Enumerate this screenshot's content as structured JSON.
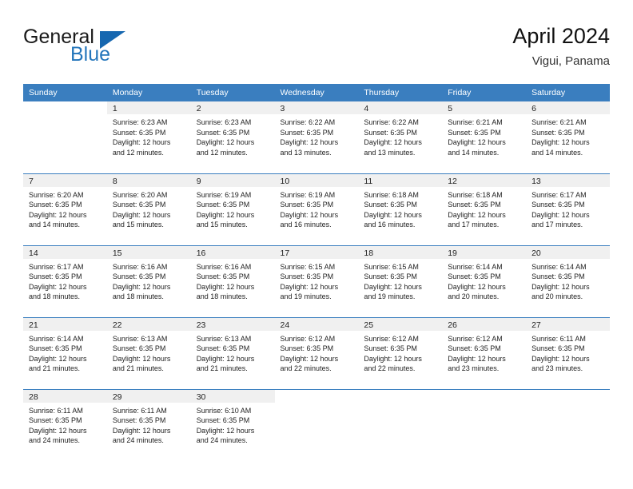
{
  "logo": {
    "word_one": "General",
    "word_two": "Blue",
    "triangle": "blue-triangle"
  },
  "header": {
    "title": "April 2024",
    "subtitle": "Vigui, Panama"
  },
  "colors": {
    "header_blue": "#3a7ebf",
    "daynum_bg": "#f0f0f0",
    "logo_blue": "#2375bb",
    "text": "#222222"
  },
  "weekdays": [
    "Sunday",
    "Monday",
    "Tuesday",
    "Wednesday",
    "Thursday",
    "Friday",
    "Saturday"
  ],
  "weeks": [
    [
      {
        "day": "",
        "lines": [
          "",
          "",
          "",
          ""
        ]
      },
      {
        "day": "1",
        "lines": [
          "Sunrise: 6:23 AM",
          "Sunset: 6:35 PM",
          "Daylight: 12 hours",
          "and 12 minutes."
        ]
      },
      {
        "day": "2",
        "lines": [
          "Sunrise: 6:23 AM",
          "Sunset: 6:35 PM",
          "Daylight: 12 hours",
          "and 12 minutes."
        ]
      },
      {
        "day": "3",
        "lines": [
          "Sunrise: 6:22 AM",
          "Sunset: 6:35 PM",
          "Daylight: 12 hours",
          "and 13 minutes."
        ]
      },
      {
        "day": "4",
        "lines": [
          "Sunrise: 6:22 AM",
          "Sunset: 6:35 PM",
          "Daylight: 12 hours",
          "and 13 minutes."
        ]
      },
      {
        "day": "5",
        "lines": [
          "Sunrise: 6:21 AM",
          "Sunset: 6:35 PM",
          "Daylight: 12 hours",
          "and 14 minutes."
        ]
      },
      {
        "day": "6",
        "lines": [
          "Sunrise: 6:21 AM",
          "Sunset: 6:35 PM",
          "Daylight: 12 hours",
          "and 14 minutes."
        ]
      }
    ],
    [
      {
        "day": "7",
        "lines": [
          "Sunrise: 6:20 AM",
          "Sunset: 6:35 PM",
          "Daylight: 12 hours",
          "and 14 minutes."
        ]
      },
      {
        "day": "8",
        "lines": [
          "Sunrise: 6:20 AM",
          "Sunset: 6:35 PM",
          "Daylight: 12 hours",
          "and 15 minutes."
        ]
      },
      {
        "day": "9",
        "lines": [
          "Sunrise: 6:19 AM",
          "Sunset: 6:35 PM",
          "Daylight: 12 hours",
          "and 15 minutes."
        ]
      },
      {
        "day": "10",
        "lines": [
          "Sunrise: 6:19 AM",
          "Sunset: 6:35 PM",
          "Daylight: 12 hours",
          "and 16 minutes."
        ]
      },
      {
        "day": "11",
        "lines": [
          "Sunrise: 6:18 AM",
          "Sunset: 6:35 PM",
          "Daylight: 12 hours",
          "and 16 minutes."
        ]
      },
      {
        "day": "12",
        "lines": [
          "Sunrise: 6:18 AM",
          "Sunset: 6:35 PM",
          "Daylight: 12 hours",
          "and 17 minutes."
        ]
      },
      {
        "day": "13",
        "lines": [
          "Sunrise: 6:17 AM",
          "Sunset: 6:35 PM",
          "Daylight: 12 hours",
          "and 17 minutes."
        ]
      }
    ],
    [
      {
        "day": "14",
        "lines": [
          "Sunrise: 6:17 AM",
          "Sunset: 6:35 PM",
          "Daylight: 12 hours",
          "and 18 minutes."
        ]
      },
      {
        "day": "15",
        "lines": [
          "Sunrise: 6:16 AM",
          "Sunset: 6:35 PM",
          "Daylight: 12 hours",
          "and 18 minutes."
        ]
      },
      {
        "day": "16",
        "lines": [
          "Sunrise: 6:16 AM",
          "Sunset: 6:35 PM",
          "Daylight: 12 hours",
          "and 18 minutes."
        ]
      },
      {
        "day": "17",
        "lines": [
          "Sunrise: 6:15 AM",
          "Sunset: 6:35 PM",
          "Daylight: 12 hours",
          "and 19 minutes."
        ]
      },
      {
        "day": "18",
        "lines": [
          "Sunrise: 6:15 AM",
          "Sunset: 6:35 PM",
          "Daylight: 12 hours",
          "and 19 minutes."
        ]
      },
      {
        "day": "19",
        "lines": [
          "Sunrise: 6:14 AM",
          "Sunset: 6:35 PM",
          "Daylight: 12 hours",
          "and 20 minutes."
        ]
      },
      {
        "day": "20",
        "lines": [
          "Sunrise: 6:14 AM",
          "Sunset: 6:35 PM",
          "Daylight: 12 hours",
          "and 20 minutes."
        ]
      }
    ],
    [
      {
        "day": "21",
        "lines": [
          "Sunrise: 6:14 AM",
          "Sunset: 6:35 PM",
          "Daylight: 12 hours",
          "and 21 minutes."
        ]
      },
      {
        "day": "22",
        "lines": [
          "Sunrise: 6:13 AM",
          "Sunset: 6:35 PM",
          "Daylight: 12 hours",
          "and 21 minutes."
        ]
      },
      {
        "day": "23",
        "lines": [
          "Sunrise: 6:13 AM",
          "Sunset: 6:35 PM",
          "Daylight: 12 hours",
          "and 21 minutes."
        ]
      },
      {
        "day": "24",
        "lines": [
          "Sunrise: 6:12 AM",
          "Sunset: 6:35 PM",
          "Daylight: 12 hours",
          "and 22 minutes."
        ]
      },
      {
        "day": "25",
        "lines": [
          "Sunrise: 6:12 AM",
          "Sunset: 6:35 PM",
          "Daylight: 12 hours",
          "and 22 minutes."
        ]
      },
      {
        "day": "26",
        "lines": [
          "Sunrise: 6:12 AM",
          "Sunset: 6:35 PM",
          "Daylight: 12 hours",
          "and 23 minutes."
        ]
      },
      {
        "day": "27",
        "lines": [
          "Sunrise: 6:11 AM",
          "Sunset: 6:35 PM",
          "Daylight: 12 hours",
          "and 23 minutes."
        ]
      }
    ],
    [
      {
        "day": "28",
        "lines": [
          "Sunrise: 6:11 AM",
          "Sunset: 6:35 PM",
          "Daylight: 12 hours",
          "and 24 minutes."
        ]
      },
      {
        "day": "29",
        "lines": [
          "Sunrise: 6:11 AM",
          "Sunset: 6:35 PM",
          "Daylight: 12 hours",
          "and 24 minutes."
        ]
      },
      {
        "day": "30",
        "lines": [
          "Sunrise: 6:10 AM",
          "Sunset: 6:35 PM",
          "Daylight: 12 hours",
          "and 24 minutes."
        ]
      },
      {
        "day": "",
        "lines": [
          "",
          "",
          "",
          ""
        ]
      },
      {
        "day": "",
        "lines": [
          "",
          "",
          "",
          ""
        ]
      },
      {
        "day": "",
        "lines": [
          "",
          "",
          "",
          ""
        ]
      },
      {
        "day": "",
        "lines": [
          "",
          "",
          "",
          ""
        ]
      }
    ]
  ]
}
